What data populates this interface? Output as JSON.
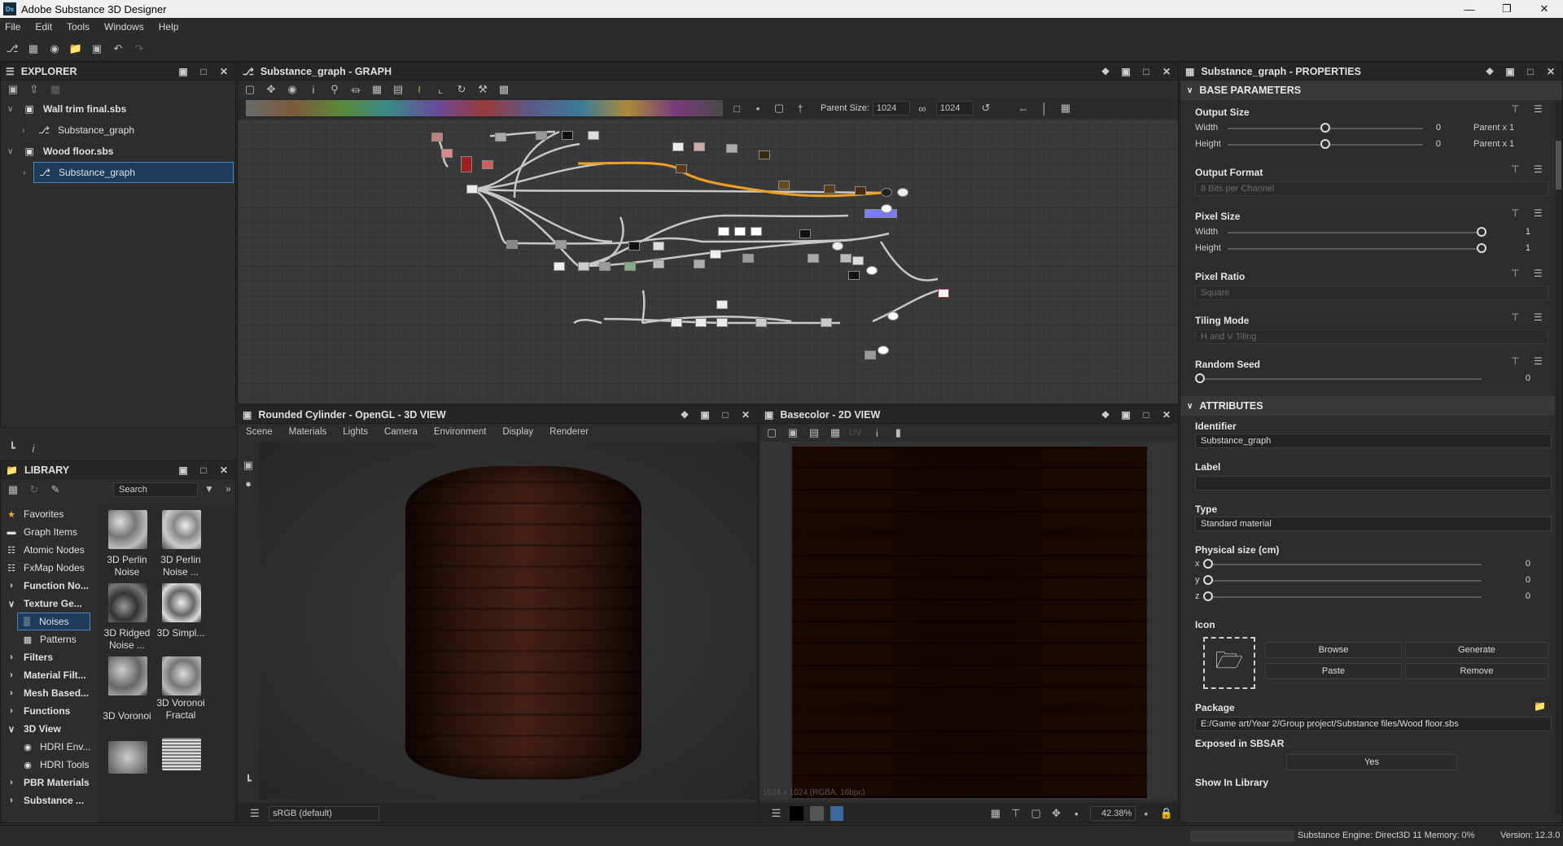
{
  "window": {
    "title": "Adobe Substance 3D Designer",
    "logo": "Ds"
  },
  "menu": [
    "File",
    "Edit",
    "Tools",
    "Windows",
    "Help"
  ],
  "explorer": {
    "title": "EXPLORER",
    "items": [
      {
        "label": "Wall trim final.sbs",
        "level": 0
      },
      {
        "label": "Substance_graph",
        "level": 1
      },
      {
        "label": "Wood floor.sbs",
        "level": 0
      },
      {
        "label": "Substance_graph",
        "level": 1,
        "selected": true
      }
    ]
  },
  "library": {
    "title": "LIBRARY",
    "search_placeholder": "Search",
    "categories": [
      {
        "label": "Favorites",
        "icon": "star-icon"
      },
      {
        "label": "Graph Items"
      },
      {
        "label": "Atomic Nodes"
      },
      {
        "label": "FxMap Nodes"
      },
      {
        "label": "Function No..."
      },
      {
        "label": "Texture Ge..."
      },
      {
        "label": "Noises",
        "selected": true
      },
      {
        "label": "Patterns"
      },
      {
        "label": "Filters"
      },
      {
        "label": "Material Filt..."
      },
      {
        "label": "Mesh Based..."
      },
      {
        "label": "Functions"
      },
      {
        "label": "3D View"
      },
      {
        "label": "HDRI Env..."
      },
      {
        "label": "HDRI Tools"
      },
      {
        "label": "PBR Materials"
      },
      {
        "label": "Substance ..."
      }
    ],
    "thumbs": [
      "3D Perlin Noise",
      "3D Perlin Noise ...",
      "3D Ridged Noise ...",
      "3D Simpl...",
      "3D Voronoi",
      "3D Voronoi Fractal"
    ]
  },
  "graph": {
    "title": "Substance_graph - GRAPH",
    "parent_size_label": "Parent Size:",
    "parent_size": "1024",
    "size2": "1024"
  },
  "view3d": {
    "title": "Rounded Cylinder - OpenGL - 3D VIEW",
    "menu": [
      "Scene",
      "Materials",
      "Lights",
      "Camera",
      "Environment",
      "Display",
      "Renderer"
    ],
    "colorspace": "sRGB (default)"
  },
  "view2d": {
    "title": "Basecolor - 2D VIEW",
    "info": "1024 x 1024 (RGBA, 16bpc)",
    "zoom": "42.38%",
    "uv": "UV"
  },
  "properties": {
    "title": "Substance_graph - PROPERTIES",
    "base_parameters": "BASE PARAMETERS",
    "output_size": {
      "label": "Output Size",
      "width_label": "Width",
      "height_label": "Height",
      "width_val": "0",
      "height_val": "0",
      "width_rel": "Parent x 1",
      "height_rel": "Parent x 1",
      "width_frac": 0.45,
      "height_frac": 0.45
    },
    "output_format": {
      "label": "Output Format",
      "value": "8 Bits per Channel"
    },
    "pixel_size": {
      "label": "Pixel Size",
      "width_label": "Width",
      "height_label": "Height",
      "width_val": "1",
      "height_val": "1",
      "width_frac": 1.0,
      "height_frac": 1.0
    },
    "pixel_ratio": {
      "label": "Pixel Ratio",
      "value": "Square"
    },
    "tiling_mode": {
      "label": "Tiling Mode",
      "value": "H and V Tiling"
    },
    "random_seed": {
      "label": "Random Seed",
      "value": "0",
      "frac": 0
    },
    "attributes": "ATTRIBUTES",
    "identifier": {
      "label": "Identifier",
      "value": "Substance_graph"
    },
    "label": {
      "label": "Label",
      "value": ""
    },
    "type": {
      "label": "Type",
      "value": "Standard material"
    },
    "physical": {
      "label": "Physical size (cm)",
      "x_label": "x",
      "y_label": "y",
      "z_label": "z",
      "x": "0",
      "y": "0",
      "z": "0"
    },
    "icon": {
      "label": "Icon",
      "browse": "Browse",
      "generate": "Generate",
      "paste": "Paste",
      "remove": "Remove"
    },
    "package": {
      "label": "Package",
      "value": "E:/Game art/Year 2/Group project/Substance files/Wood floor.sbs"
    },
    "exposed": {
      "label": "Exposed in SBSAR",
      "value": "Yes"
    },
    "show_in_library": {
      "label": "Show In Library"
    }
  },
  "status": {
    "engine": "Substance Engine: Direct3D 11 Memory: 0%",
    "version": "Version: 12.3.0"
  }
}
